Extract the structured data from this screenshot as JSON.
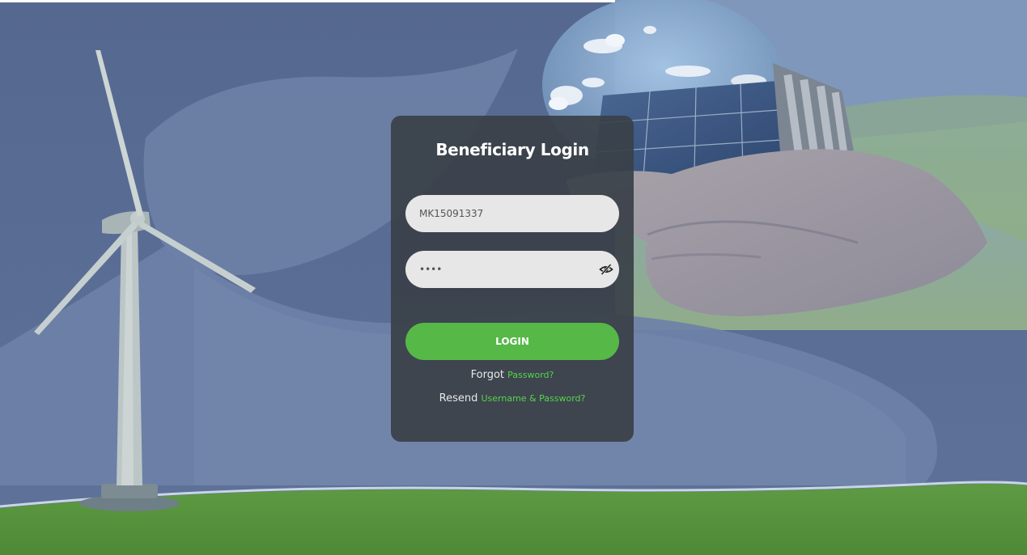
{
  "login": {
    "title": "Beneficiary Login",
    "username_value": "MK15091337",
    "password_value": "••••",
    "login_label": "LOGIN",
    "forgot_prefix": "Forgot",
    "forgot_link": "Password?",
    "resend_prefix": "Resend",
    "resend_link": "Username & Password?"
  },
  "icons": {
    "password_toggle": "eye-slash-icon"
  },
  "colors": {
    "accent_green": "#56b847",
    "link_green": "#57d44b",
    "card_bg": "#3a4048",
    "field_bg": "#e7e7e7"
  }
}
